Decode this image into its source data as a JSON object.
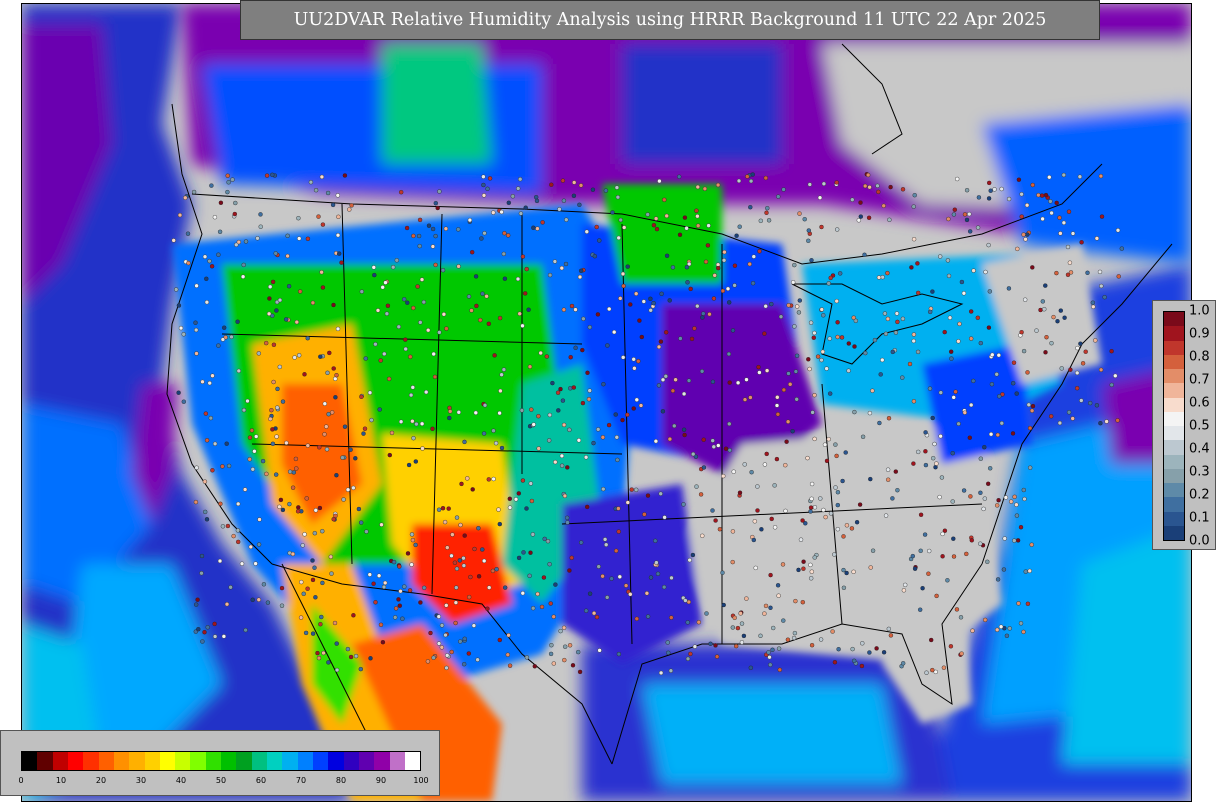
{
  "title": "UU2DVAR Relative Humidity Analysis using HRRR Background 11 UTC 22 Apr 2025",
  "rh_colorbar": {
    "ticks": [
      "0",
      "10",
      "20",
      "30",
      "40",
      "50",
      "60",
      "70",
      "80",
      "90",
      "100"
    ],
    "colors": [
      "#000000",
      "#600000",
      "#c00000",
      "#ff0000",
      "#ff3000",
      "#ff6000",
      "#ff9000",
      "#ffb000",
      "#ffd000",
      "#ffff00",
      "#c8ff00",
      "#80ff00",
      "#30e000",
      "#00c000",
      "#00a020",
      "#00c080",
      "#00d0c0",
      "#00b0f0",
      "#0080ff",
      "#0040ff",
      "#0000e0",
      "#3000c0",
      "#6000b0",
      "#9000a8",
      "#c070c8",
      "#ffffff"
    ]
  },
  "fraction_colorbar": {
    "ticks": [
      "1.0",
      "0.9",
      "0.8",
      "0.7",
      "0.6",
      "0.5",
      "0.4",
      "0.3",
      "0.2",
      "0.1",
      "0.0"
    ],
    "colors": [
      "#7a0a1a",
      "#a0141e",
      "#c0362c",
      "#d4603c",
      "#e38d68",
      "#f0b59a",
      "#f8dccd",
      "#f4f4f4",
      "#e2e6ea",
      "#bcc8d0",
      "#9cb4bc",
      "#86a0aa",
      "#5e8aa8",
      "#3f6fa0",
      "#2a5590",
      "#1a3f78"
    ]
  },
  "map_colors": {
    "land_bg": "#c8c8c8",
    "dry": "#ff8000",
    "very_dry": "#e00000",
    "mid": "#00c800",
    "moist": "#0050ff",
    "very_moist": "#7a00b0",
    "ocean_deep": "#2020c0",
    "ocean_mid": "#00a0ff",
    "border": "#000000"
  }
}
